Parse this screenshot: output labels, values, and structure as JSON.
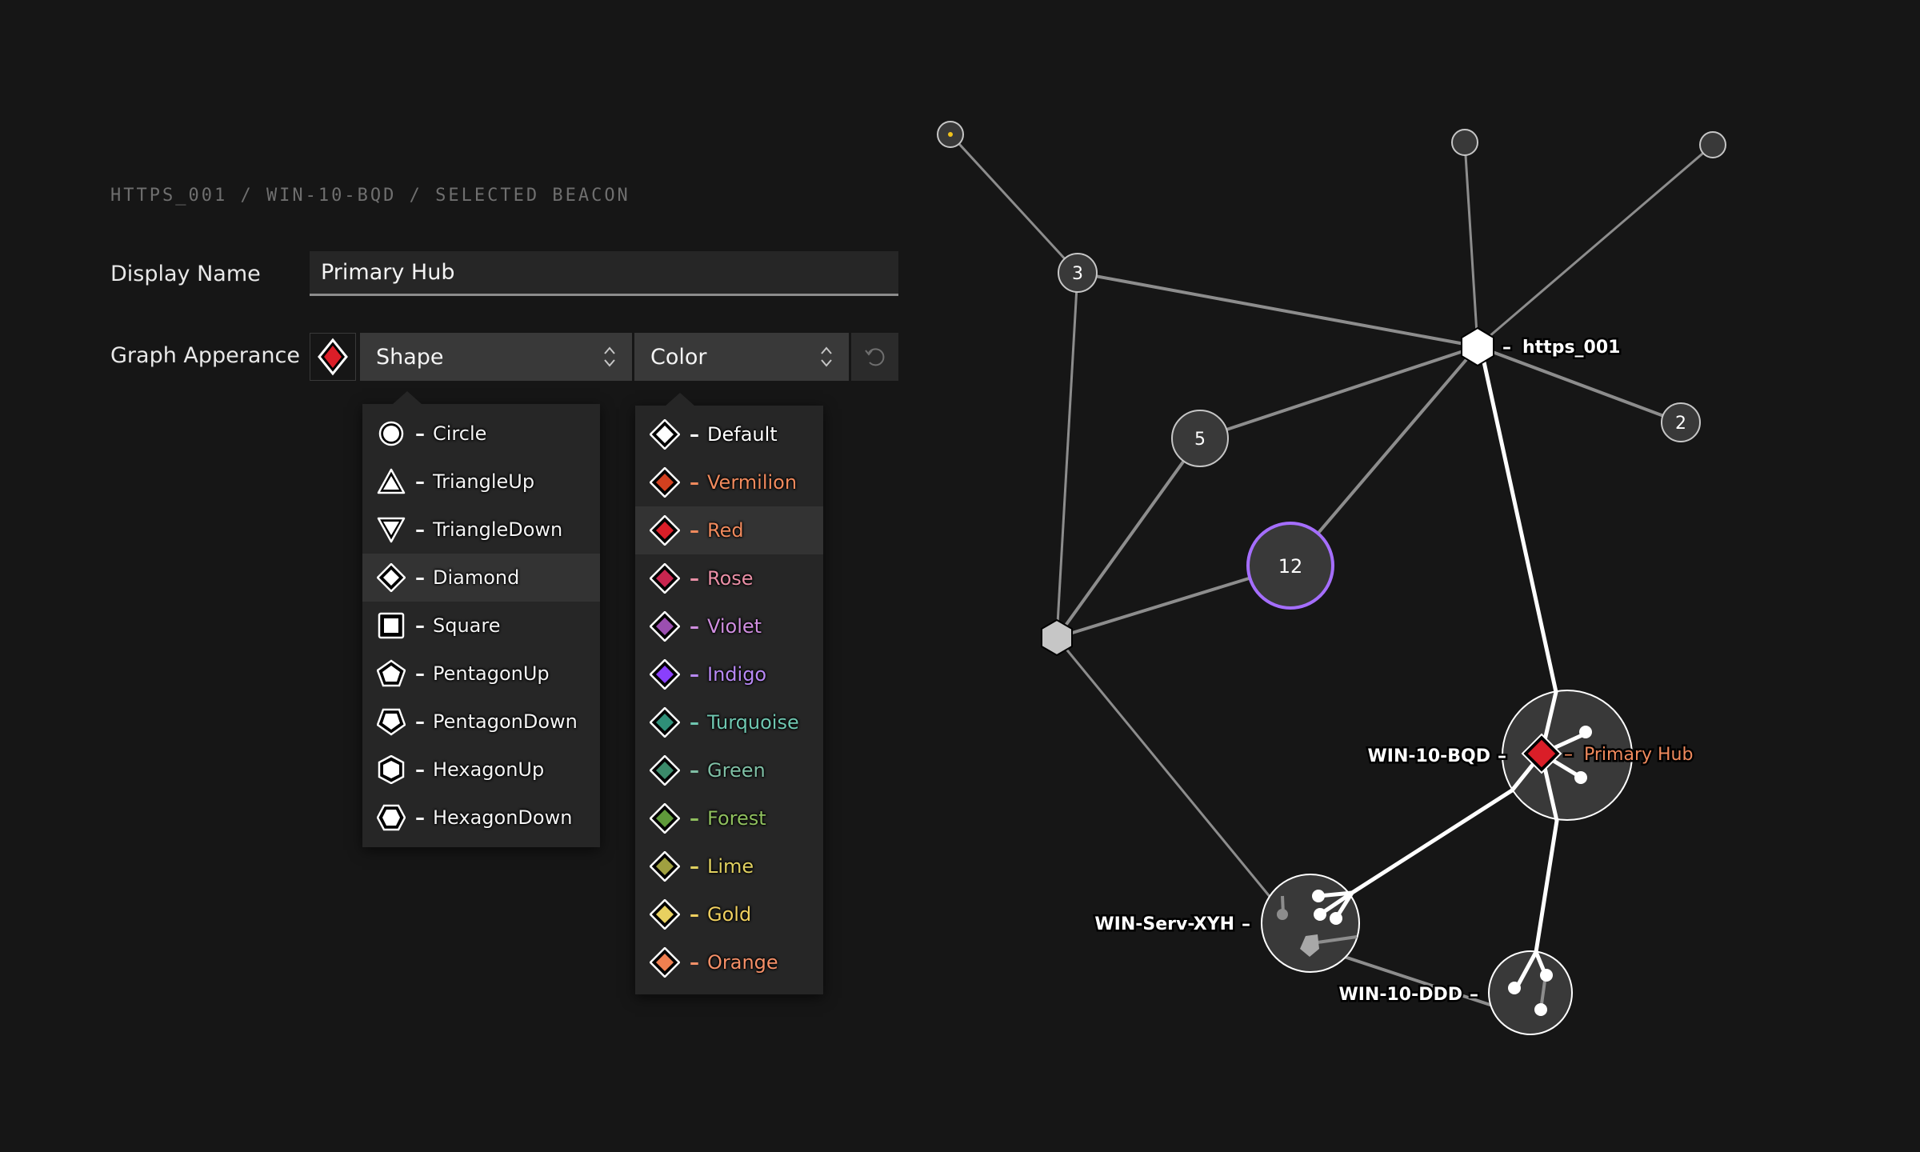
{
  "breadcrumb": "HTTPS_001 / WIN-10-BQD / SELECTED BEACON",
  "display_name": {
    "label": "Display Name",
    "value": "Primary Hub"
  },
  "graph_appearance": {
    "label": "Graph Apperance",
    "current_swatch": {
      "shape": "diamond",
      "color": "#da1e28"
    },
    "shape_select": "Shape",
    "color_select": "Color",
    "reset_icon": "reset-icon"
  },
  "shape_menu": {
    "highlighted": "Diamond",
    "items": [
      {
        "label": "Circle",
        "icon": "circle"
      },
      {
        "label": "TriangleUp",
        "icon": "triangle-up"
      },
      {
        "label": "TriangleDown",
        "icon": "triangle-down"
      },
      {
        "label": "Diamond",
        "icon": "diamond"
      },
      {
        "label": "Square",
        "icon": "square"
      },
      {
        "label": "PentagonUp",
        "icon": "pentagon-up"
      },
      {
        "label": "PentagonDown",
        "icon": "pentagon-down"
      },
      {
        "label": "HexagonUp",
        "icon": "hexagon-up"
      },
      {
        "label": "HexagonDown",
        "icon": "hexagon-down"
      }
    ]
  },
  "color_menu": {
    "highlighted": "Red",
    "items": [
      {
        "label": "Default",
        "fill": "#ffffff",
        "text": "#ffffff"
      },
      {
        "label": "Vermilion",
        "fill": "#d2401f",
        "text": "#f08a5d"
      },
      {
        "label": "Red",
        "fill": "#da1e28",
        "text": "#f08a5d"
      },
      {
        "label": "Rose",
        "fill": "#c8254f",
        "text": "#e98fa6"
      },
      {
        "label": "Violet",
        "fill": "#9b4fb0",
        "text": "#d08ee0"
      },
      {
        "label": "Indigo",
        "fill": "#8a3ffc",
        "text": "#b889f5"
      },
      {
        "label": "Turquoise",
        "fill": "#2f8f78",
        "text": "#6fc7b1"
      },
      {
        "label": "Green",
        "fill": "#3b8a6a",
        "text": "#7fbfa5"
      },
      {
        "label": "Forest",
        "fill": "#5f9a3a",
        "text": "#8fbf5e"
      },
      {
        "label": "Lime",
        "fill": "#a0a040",
        "text": "#e0d060"
      },
      {
        "label": "Gold",
        "fill": "#e8d060",
        "text": "#f0d060"
      },
      {
        "label": "Orange",
        "fill": "#f07f50",
        "text": "#f59068"
      }
    ]
  },
  "graph": {
    "nodes": {
      "count_3": "3",
      "count_5": "5",
      "count_12": "12",
      "count_2": "2",
      "https": "https_001",
      "bqd": "WIN-10-BQD",
      "bqd_display": "Primary Hub",
      "xyh": "WIN-Serv-XYH",
      "ddd": "WIN-10-DDD"
    },
    "colors": {
      "selected_ring": "#a56eff",
      "highlight_label": "#f08a5d",
      "beacon": "#da1e28"
    }
  }
}
